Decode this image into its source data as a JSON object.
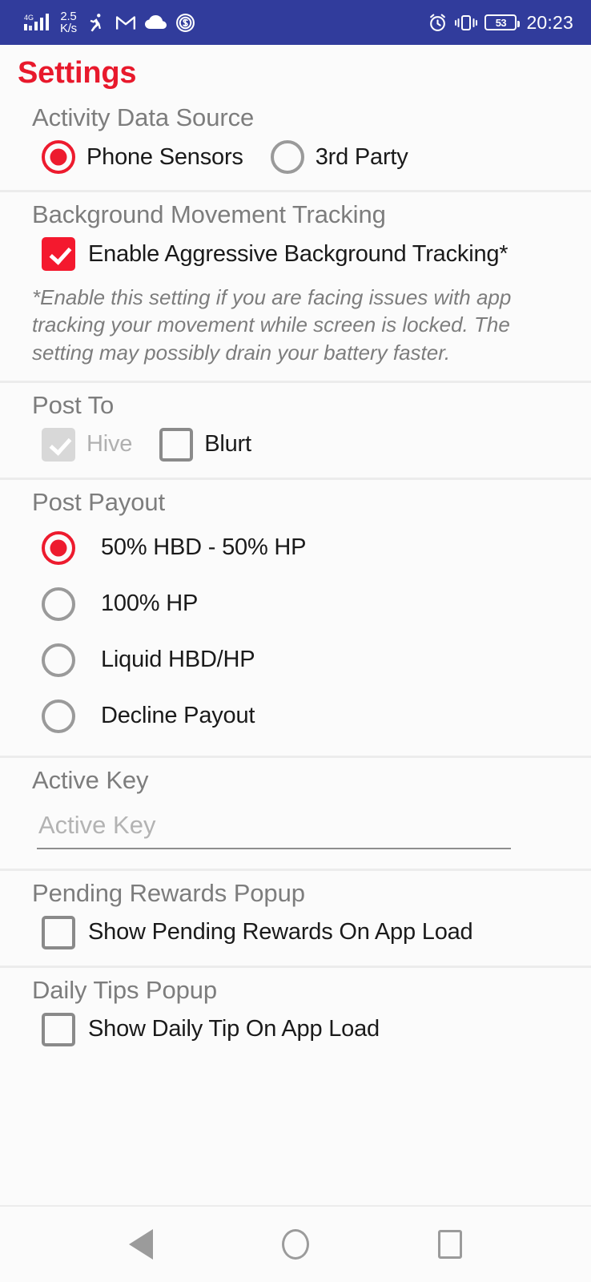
{
  "status_bar": {
    "network_type": "4G",
    "net_speed_value": "2.5",
    "net_speed_unit": "K/s",
    "icons": [
      "signal-icon",
      "fitness-icon",
      "gmail-icon",
      "cloud-icon",
      "coin-icon",
      "alarm-icon",
      "vibrate-icon"
    ],
    "battery_level": "53",
    "time": "20:23",
    "background_color": "#313c9c"
  },
  "header": {
    "title": "Settings",
    "title_color": "#e8192c"
  },
  "sections": {
    "activity_data_source": {
      "title": "Activity Data Source",
      "options": [
        {
          "label": "Phone Sensors",
          "selected": true
        },
        {
          "label": "3rd Party",
          "selected": false
        }
      ]
    },
    "background_movement_tracking": {
      "title": "Background Movement Tracking",
      "checkbox_label": "Enable Aggressive Background Tracking*",
      "checked": true,
      "help_text": "*Enable this setting if you are facing issues with app tracking your movement while screen is locked. The setting may possibly drain your battery faster."
    },
    "post_to": {
      "title": "Post To",
      "options": [
        {
          "label": "Hive",
          "checked": true,
          "disabled": true
        },
        {
          "label": "Blurt",
          "checked": false,
          "disabled": false
        }
      ]
    },
    "post_payout": {
      "title": "Post Payout",
      "options": [
        {
          "label": "50% HBD - 50% HP",
          "selected": true
        },
        {
          "label": "100% HP",
          "selected": false
        },
        {
          "label": "Liquid HBD/HP",
          "selected": false
        },
        {
          "label": "Decline Payout",
          "selected": false
        }
      ]
    },
    "active_key": {
      "title": "Active Key",
      "input_value": "",
      "input_placeholder": "Active Key"
    },
    "pending_rewards_popup": {
      "title": "Pending Rewards Popup",
      "checkbox_label": "Show Pending Rewards On App Load",
      "checked": false
    },
    "daily_tips_popup": {
      "title": "Daily Tips Popup",
      "checkbox_label": "Show Daily Tip On App Load",
      "checked": false
    }
  },
  "nav_bar": {
    "back_label": "Back",
    "home_label": "Home",
    "recents_label": "Recents"
  },
  "colors": {
    "accent_red": "#ed1b2e",
    "status_bar_blue": "#313c9c",
    "section_title_grey": "#7d7d7d",
    "background": "#fbfbfb"
  }
}
